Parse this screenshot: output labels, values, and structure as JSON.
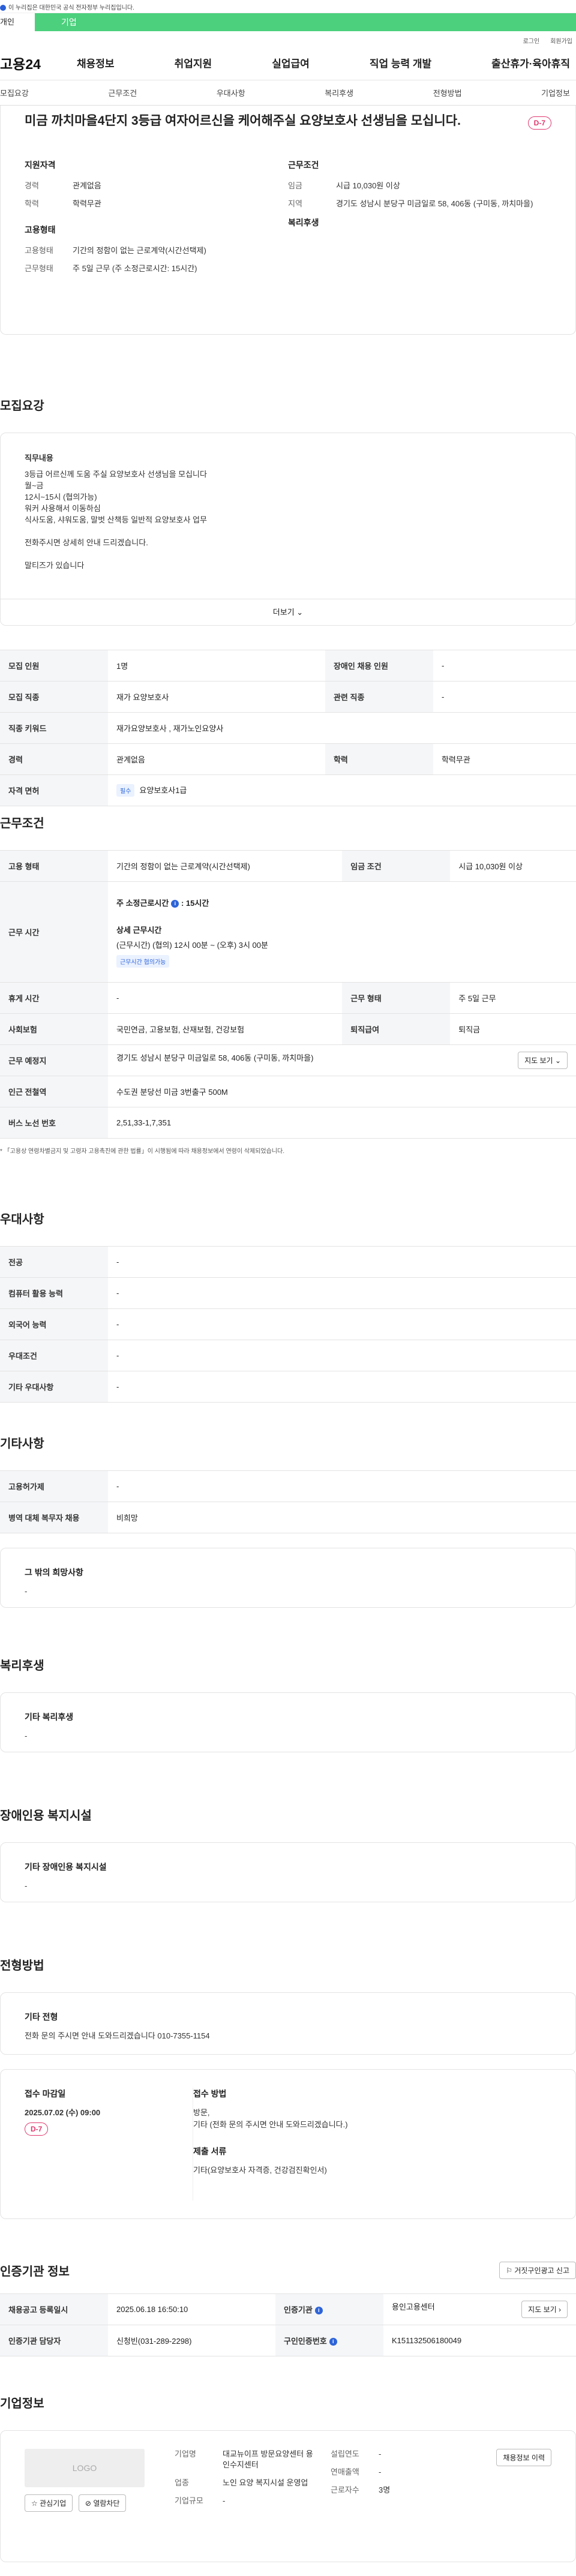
{
  "gov_banner": "이 누리집은 대한민국 공식 전자정부 누리집입니다.",
  "top_tabs": [
    "개인",
    "기업"
  ],
  "util": [
    "로그인",
    "회원가입"
  ],
  "gnb": {
    "logo": "고용24",
    "menu": [
      "채용정보",
      "취업지원",
      "실업급여",
      "직업 능력 개발",
      "출산휴가·육아휴직"
    ]
  },
  "lnb": [
    "모집요강",
    "근무조건",
    "우대사항",
    "복리후생",
    "전형방법",
    "기업정보"
  ],
  "header": {
    "title": "미금 까치마을4단지 3등급 여자어르신을 케어해주실 요양보호사 선생님을 모십니다.",
    "dday": "D-7",
    "applicant_title": "지원자격",
    "applicant": [
      {
        "k": "경력",
        "v": "관계없음"
      },
      {
        "k": "학력",
        "v": "학력무관"
      }
    ],
    "employ_title": "고용형태",
    "employ": [
      {
        "k": "고용형태",
        "v": "기간의 정함이 없는 근로계약(시간선택제)"
      },
      {
        "k": "근무형태",
        "v": "주 5일 근무 (주 소정근로시간: 15시간)"
      }
    ],
    "work_title": "근무조건",
    "work": [
      {
        "k": "임금",
        "v": "시급 10,030원 이상"
      },
      {
        "k": "지역",
        "v": "경기도 성남시 분당구 미금일로 58, 406동 (구미동, 까치마을)"
      }
    ],
    "welfare_title": "복리후생"
  },
  "recruit": {
    "title": "모집요강",
    "content_title": "직무내용",
    "content": [
      "3등급 어르신께 도움 주실 요양보호사 선생님을 모십니다",
      "월~금",
      "12시~15시 (협의가능)",
      "워커 사용해서 이동하심",
      "식사도움, 샤워도움, 말벗 산책등 일반적 요양보호사 업무",
      "",
      "전화주시면 상세히 안내 드리겠습니다.",
      "",
      "말티즈가 있습니다"
    ],
    "more": "더보기",
    "rows": [
      {
        "k1": "모집 인원",
        "v1": "1명",
        "k2": "장애인 채용 인원",
        "v2": "-"
      },
      {
        "k1": "모집 직종",
        "v1": "재가 요양보호사",
        "k2": "관련 직종",
        "v2": "-"
      },
      {
        "k1": "직종 키워드",
        "v1": "재가요양보호사 , 재가노인요양사"
      },
      {
        "k1": "경력",
        "v1": "관계없음",
        "k2": "학력",
        "v2": "학력무관"
      },
      {
        "k1": "자격 면허",
        "tag": "필수",
        "v1": "요양보호사1급"
      }
    ]
  },
  "conditions": {
    "title": "근무조건",
    "employ_k": "고용 형태",
    "employ_v": "기간의 정함이 없는 근로계약(시간선택제)",
    "wage_k": "임금 조건",
    "wage_v": "시급 10,030원 이상",
    "time_k": "근무 시간",
    "time_weekly": "주 소정근로시간",
    "time_weekly_v": ": 15시간",
    "time_detail_title": "상세 근무시간",
    "time_detail": "(근무시간) (협의) 12시 00분 ~ (오후) 3시 00분",
    "time_tag": "근무시간 협의가능",
    "rest_k": "휴게 시간",
    "rest_v": "-",
    "form_k": "근무 형태",
    "form_v": "주 5일 근무",
    "ins_k": "사회보험",
    "ins_v": "국민연금, 고용보험, 산재보험, 건강보험",
    "ret_k": "퇴직급여",
    "ret_v": "퇴직금",
    "place_k": "근무 예정지",
    "place_v": "경기도 성남시 분당구 미금일로 58, 406동 (구미동, 까치마을)",
    "map": "지도 보기",
    "subway_k": "인근 전철역",
    "subway_v": "수도권 분당선 미금 3번출구 500M",
    "bus_k": "버스 노선 번호",
    "bus_v": "2,51,33-1,7,351",
    "note": "* 「고용상 연령차별금지 및 고령자 고용촉진에 관한 법률」이 시행됨에 따라 채용정보에서 연령이 삭제되었습니다."
  },
  "preference": {
    "title": "우대사항",
    "rows": [
      {
        "k": "전공",
        "v": "-"
      },
      {
        "k": "컴퓨터 활용 능력",
        "v": "-"
      },
      {
        "k": "외국어 능력",
        "v": "-"
      },
      {
        "k": "우대조건",
        "v": "-"
      },
      {
        "k": "기타 우대사항",
        "v": "-"
      }
    ]
  },
  "etc": {
    "title": "기타사항",
    "rows": [
      {
        "k": "고용허가제",
        "v": "-"
      },
      {
        "k": "병역 대체 복무자 채용",
        "v": "비희망"
      }
    ],
    "hope_title": "그 밖의 희망사항",
    "hope_v": "-"
  },
  "welfare": {
    "title": "복리후생",
    "sub": "기타 복리후생",
    "v": "-"
  },
  "disabled": {
    "title": "장애인용 복지시설",
    "sub": "기타 장애인용 복지시설",
    "v": "-"
  },
  "selection": {
    "title": "전형방법",
    "etc_title": "기타 전형",
    "etc_v": "전화 문의 주시면 안내 도와드리겠습니다 010-7355-1154",
    "deadline_title": "접수 마감일",
    "deadline": "2025.07.02 (수) 09:00",
    "dday": "D-7",
    "method_title": "접수 방법",
    "method": [
      "방문,",
      "기타 (전화 문의 주시면 안내 도와드리겠습니다.)"
    ],
    "docs_title": "제출 서류",
    "docs": "기타(요양보호사 자격증, 건강검진확인서)"
  },
  "cert": {
    "title": "인증기관 정보",
    "report": "거짓구인광고 신고",
    "reg_k": "채용공고 등록일시",
    "reg_v": "2025.06.18 16:50:10",
    "org_k": "인증기관",
    "org_v": "용인고용센터",
    "mgr_k": "인증기관 담당자",
    "mgr_v": "신청빈(031-289-2298)",
    "no_k": "구인인증번호",
    "no_v": "K151132506180049",
    "map": "지도 보기"
  },
  "company": {
    "title": "기업정보",
    "logo": "LOGO",
    "interest": "관심기업",
    "block": "열람차단",
    "type_k": "기업명",
    "type_v": "대교뉴이프 방문요양센터 용인수지센터",
    "biz_k": "업종",
    "biz_v": "노인 요양 복지시설 운영업",
    "scale_k": "기업규모",
    "scale_v": "-",
    "year_k": "설립연도",
    "year_v": "-",
    "sales_k": "연매출액",
    "sales_v": "-",
    "emp_k": "근로자수",
    "emp_v": "3명",
    "history": "채용정보 이력"
  }
}
